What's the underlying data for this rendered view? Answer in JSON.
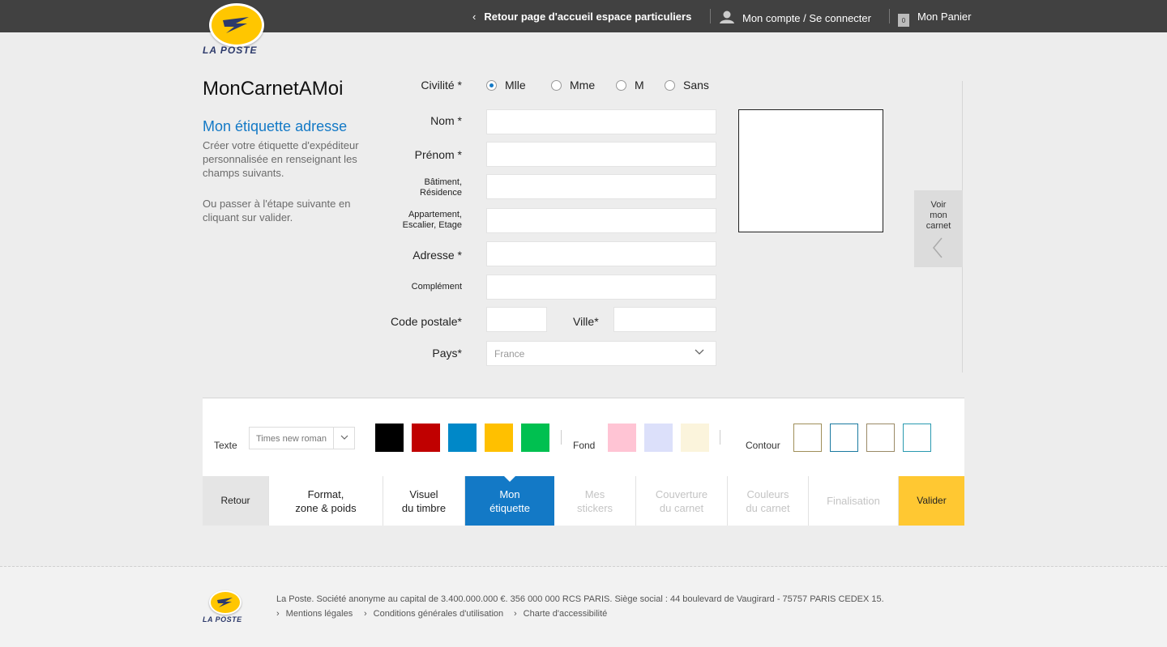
{
  "header": {
    "back_home": "Retour page d'accueil espace particuliers",
    "account": "Mon compte / Se connecter",
    "cart": "Mon Panier",
    "cart_count": "0",
    "logo_text": "LA POSTE"
  },
  "page": {
    "title": "MonCarnetAMoi",
    "section_title": "Mon étiquette adresse",
    "desc1": "Créer votre étiquette d'expéditeur personnalisée en renseignant les champs suivants.",
    "desc2": "Ou passer à l'étape suivante en cliquant sur valider."
  },
  "form": {
    "civilite_label": "Civilité *",
    "civilite_options": [
      "Mlle",
      "Mme",
      "M",
      "Sans"
    ],
    "civilite_selected": "Mlle",
    "nom": "Nom *",
    "prenom": "Prénom *",
    "batiment_l1": "Bâtiment,",
    "batiment_l2": "Résidence",
    "appart_l1": "Appartement,",
    "appart_l2": "Escalier, Etage",
    "adresse": "Adresse *",
    "complement": "Complément",
    "code_postal": "Code postale*",
    "ville": "Ville*",
    "pays": "Pays*",
    "pays_value": "France"
  },
  "preview": {
    "voir_l1": "Voir",
    "voir_l2": "mon",
    "voir_l3": "carnet"
  },
  "toolbar": {
    "texte_label": "Texte",
    "font_value": "Times new roman",
    "fond_label": "Fond",
    "contour_label": "Contour",
    "text_colors": [
      "#000000",
      "#c00000",
      "#0088c8",
      "#ffc000",
      "#00c050"
    ],
    "fond_colors": [
      "#ffc4d4",
      "#dce0fa",
      "#fbf4dc"
    ],
    "contour_colors": [
      "#a08f5a",
      "#1a7aa0",
      "#9a8a66",
      "#2a9ab0"
    ]
  },
  "steps": {
    "retour": "Retour",
    "format_l1": "Format,",
    "format_l2": "zone & poids",
    "visuel_l1": "Visuel",
    "visuel_l2": "du timbre",
    "mon_l1": "Mon",
    "mon_l2": "étiquette",
    "stickers_l1": "Mes",
    "stickers_l2": "stickers",
    "couverture_l1": "Couverture",
    "couverture_l2": "du carnet",
    "couleurs_l1": "Couleurs",
    "couleurs_l2": "du carnet",
    "finalisation": "Finalisation",
    "valider": "Valider"
  },
  "footer": {
    "legal": "La Poste. Société anonyme au capital de 3.400.000.000 €. 356 000 000 RCS PARIS. Siège social : 44 boulevard de Vaugirard - 75757 PARIS CEDEX 15.",
    "link1": "Mentions légales",
    "link2": "Conditions générales d'utilisation",
    "link3": "Charte d'accessibilité",
    "logo_text": "LA POSTE"
  }
}
